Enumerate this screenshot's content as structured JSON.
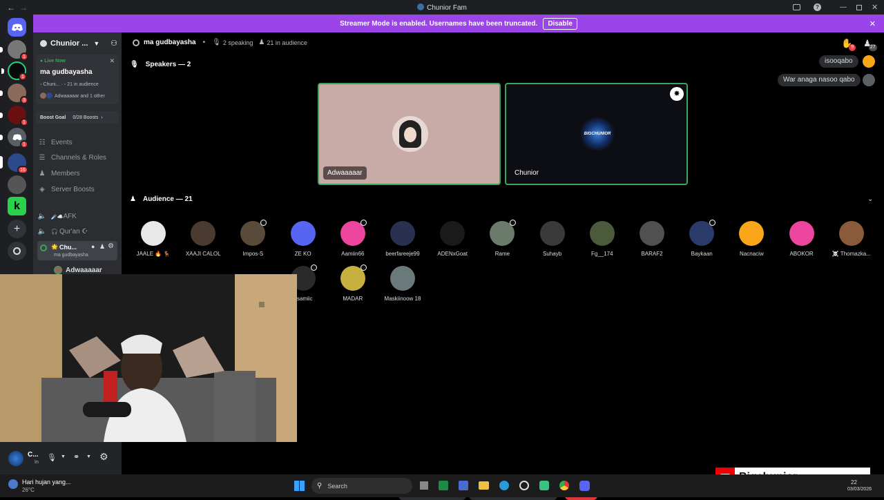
{
  "window": {
    "title": "Chunior Fam"
  },
  "banner": {
    "text": "Streamer Mode is enabled. Usernames have been truncated.",
    "button": "Disable"
  },
  "rail": {
    "badges": [
      "1",
      "1",
      "3",
      "1",
      "1",
      "16"
    ]
  },
  "sidebar": {
    "server_name": "Chunior ...",
    "live_label": "Live Now",
    "live_channel": "ma gudbayasha",
    "live_meta_server": "Chuni...",
    "live_meta_audience": "21 in audience",
    "live_meta_users": "Adwaaaaar and 1 other",
    "boost_goal": "Boost Goal",
    "boost_count": "0/28 Boosts",
    "items": [
      {
        "label": "Events",
        "icon": "calendar-icon"
      },
      {
        "label": "Channels & Roles",
        "icon": "list-icon"
      },
      {
        "label": "Members",
        "icon": "members-icon"
      },
      {
        "label": "Server Boosts",
        "icon": "boost-icon"
      }
    ],
    "channels": [
      {
        "label": "AFK",
        "prefix": "☄️☁️"
      },
      {
        "label": "Qur'an ☪",
        "prefix": "🎧"
      },
      {
        "label": "Chu...",
        "prefix": "🌟",
        "sub": "ma gudbayasha"
      }
    ],
    "voice_user": "Adwaaaaar"
  },
  "user_panel": {
    "name": "C...",
    "status": "In"
  },
  "header": {
    "stage_name": "ma gudbayasha",
    "speaking": "2 speaking",
    "audience": "21 in audience"
  },
  "speakers": {
    "title": "Speakers — 2",
    "tiles": [
      {
        "name": "Adwaaaaar"
      },
      {
        "name": "Chunior",
        "logo_text": "BIGCHUNIOR"
      }
    ]
  },
  "audience": {
    "title": "Audience — 21",
    "members": [
      {
        "name": "JAALE 🔥 🦌",
        "color": "#e8e8e8"
      },
      {
        "name": "XAAJI CALOL",
        "color": "#4a3a2f"
      },
      {
        "name": "Impos-S",
        "color": "#5a4a3a"
      },
      {
        "name": "ZE KO",
        "color": "#5865f2"
      },
      {
        "name": "Aamiin66",
        "color": "#eb459e"
      },
      {
        "name": "beerfareeje99",
        "color": "#2a3050"
      },
      {
        "name": "ADENxGoat",
        "color": "#1a1a1a"
      },
      {
        "name": "Rame",
        "color": "#6b7b6b"
      },
      {
        "name": "Suhayb",
        "color": "#3a3a3a"
      },
      {
        "name": "Fg__174",
        "color": "#4a5a3a"
      },
      {
        "name": "BARAF2",
        "color": "#505050"
      },
      {
        "name": "Baykaan",
        "color": "#2a3a6a"
      },
      {
        "name": "Nacnaciw",
        "color": "#faa61a"
      },
      {
        "name": "ABOKOR",
        "color": "#eb459e"
      },
      {
        "name": "☠️ Thomazka...",
        "color": "#8a5a3a"
      },
      {
        "name": "Ysamiic",
        "color": "#2a2a2a"
      },
      {
        "name": "MADAR",
        "color": "#c8b040"
      },
      {
        "name": "Maskiinoow 18",
        "color": "#6a7a7a"
      }
    ]
  },
  "chat": [
    {
      "text": "isooqabo"
    },
    {
      "text": "War anaga nasoo qabo"
    }
  ],
  "hand_count": "9",
  "people_count": "27",
  "taskbar": {
    "weather_text": "Hari hujan yang...",
    "weather_temp": "26°C",
    "search": "Search",
    "time": "22",
    "date": "03/03/2026"
  },
  "overlay": {
    "channel": "Bigchunior"
  },
  "colors": {
    "accent": "#9b44e8",
    "speaking": "#3ba55c",
    "danger": "#da373c",
    "blurple": "#5865f2"
  }
}
